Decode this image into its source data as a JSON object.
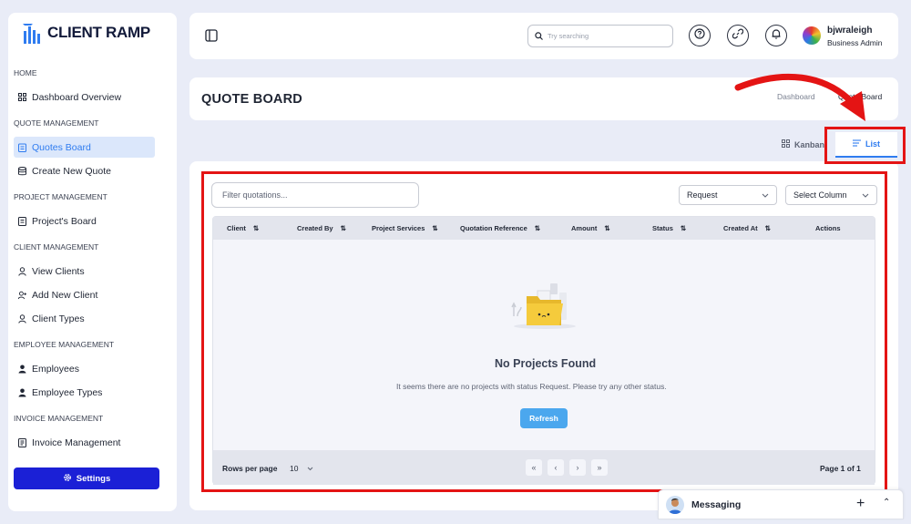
{
  "app": {
    "logo_text": "CLIENT RAMP"
  },
  "sidebar": {
    "sections": [
      {
        "label": "HOME",
        "items": [
          {
            "label": "Dashboard Overview",
            "icon": "grid-icon"
          }
        ]
      },
      {
        "label": "QUOTE MANAGEMENT",
        "items": [
          {
            "label": "Quotes Board",
            "icon": "clipboard-icon",
            "active": true
          },
          {
            "label": "Create New Quote",
            "icon": "database-icon"
          }
        ]
      },
      {
        "label": "PROJECT MANAGEMENT",
        "items": [
          {
            "label": "Project's Board",
            "icon": "board-icon"
          }
        ]
      },
      {
        "label": "CLIENT MANAGEMENT",
        "items": [
          {
            "label": "View Clients",
            "icon": "user-icon"
          },
          {
            "label": "Add New Client",
            "icon": "user-plus-icon"
          },
          {
            "label": "Client Types",
            "icon": "user-icon"
          }
        ]
      },
      {
        "label": "EMPLOYEE MANAGEMENT",
        "items": [
          {
            "label": "Employees",
            "icon": "person-icon"
          },
          {
            "label": "Employee Types",
            "icon": "person-icon"
          }
        ]
      },
      {
        "label": "INVOICE MANAGEMENT",
        "items": [
          {
            "label": "Invoice Management",
            "icon": "invoice-icon"
          }
        ]
      }
    ],
    "settings_label": "Settings"
  },
  "header": {
    "search_placeholder": "Try searching",
    "user_name": "bjwraleigh",
    "user_role": "Business Admin"
  },
  "page": {
    "title": "QUOTE BOARD",
    "breadcrumb": [
      "Dashboard",
      "Quote Board"
    ],
    "views": {
      "kanban": "Kanban",
      "list": "List",
      "active": "List"
    }
  },
  "toolbar": {
    "filter_placeholder": "Filter quotations...",
    "status_select": "Request",
    "column_select": "Select Column"
  },
  "table": {
    "columns": [
      "Client",
      "Created By",
      "Project Services",
      "Quotation Reference",
      "Amount",
      "Status",
      "Created At",
      "Actions"
    ],
    "rows": []
  },
  "empty_state": {
    "title": "No Projects Found",
    "message": "It seems there are no projects with status Request. Please try any other status.",
    "refresh_label": "Refresh"
  },
  "pagination": {
    "rows_per_page_label": "Rows per page",
    "rows_per_page": "10",
    "page_info": "Page 1 of 1"
  },
  "messaging": {
    "label": "Messaging"
  },
  "colors": {
    "accent": "#2f7cf0",
    "settings_bg": "#1b20d6",
    "annotation": "#e41414",
    "refresh": "#4ba7ee"
  }
}
